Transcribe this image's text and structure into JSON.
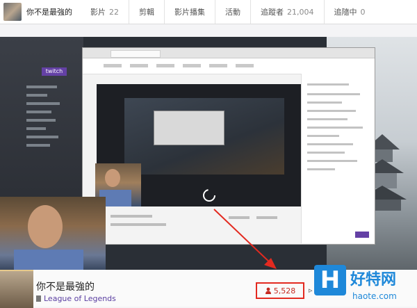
{
  "header": {
    "channel_name": "你不是最強的",
    "nav": [
      {
        "label": "影片",
        "count": "22"
      },
      {
        "label": "剪輯",
        "count": ""
      },
      {
        "label": "影片播集",
        "count": ""
      },
      {
        "label": "活動",
        "count": ""
      },
      {
        "label": "追蹤者",
        "count": "21,004"
      },
      {
        "label": "追隨中",
        "count": "0"
      }
    ]
  },
  "stream": {
    "overlay_logo": "twitch"
  },
  "info": {
    "title": "你不是最強的",
    "game": "League of Legends",
    "viewers": "5,528"
  },
  "watermark": {
    "logo": "H",
    "name_cn": "好特网",
    "domain": "haote.com"
  },
  "colors": {
    "brand_purple": "#6441a5",
    "annotation_red": "#e32a20",
    "watermark_blue": "#1e88d9"
  }
}
